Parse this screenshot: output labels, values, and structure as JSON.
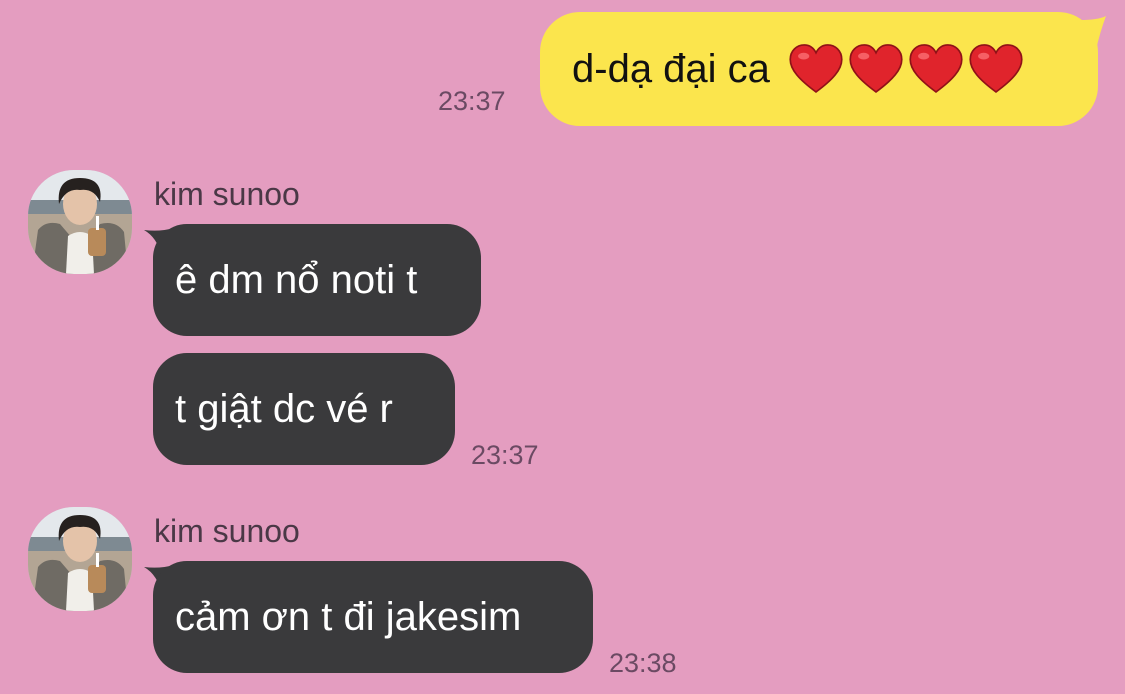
{
  "colors": {
    "background": "#e49dc0",
    "outgoing_bubble": "#fbe54d",
    "incoming_bubble": "#3a3a3c",
    "heart": "#e0242c"
  },
  "messages": [
    {
      "direction": "out",
      "text": "d-dạ đại ca",
      "emoji": [
        "red-heart-icon",
        "red-heart-icon",
        "red-heart-icon",
        "red-heart-icon"
      ],
      "time": "23:37"
    },
    {
      "direction": "in",
      "sender": "kim sunoo",
      "text": "ê dm nổ noti t"
    },
    {
      "direction": "in",
      "text": "t giật dc vé r",
      "time": "23:37"
    },
    {
      "direction": "in",
      "sender": "kim sunoo",
      "text": "cảm ơn t đi jakesim",
      "time": "23:38"
    }
  ]
}
